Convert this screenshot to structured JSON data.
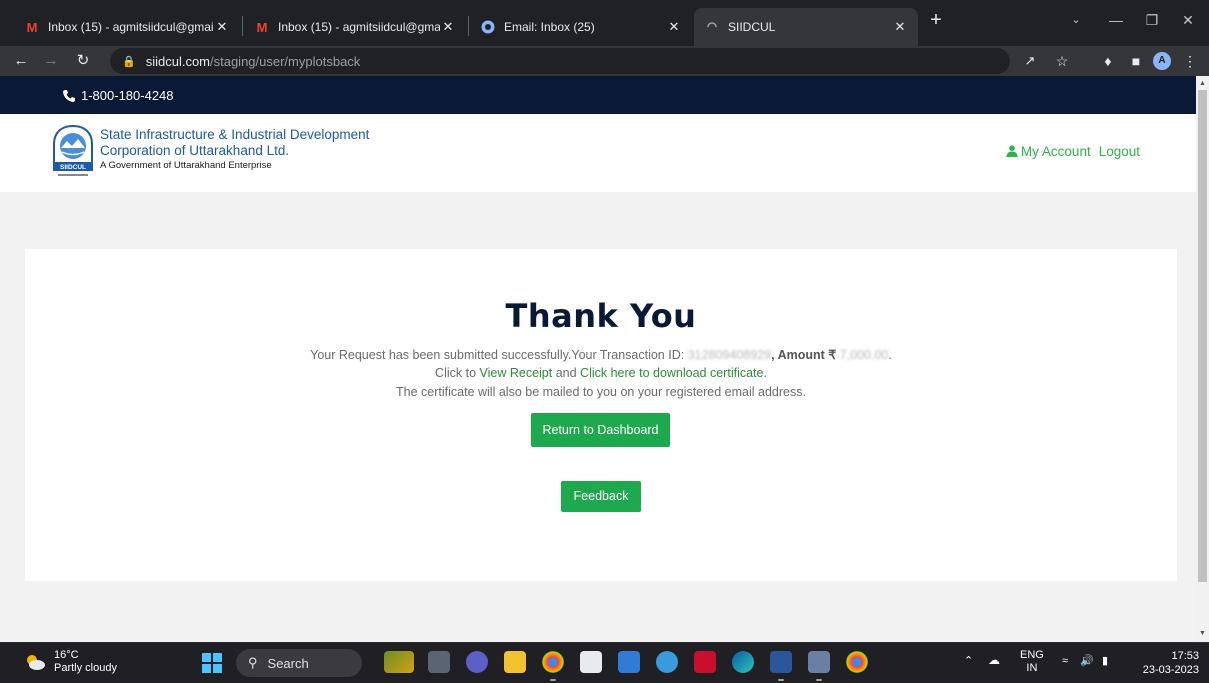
{
  "browser": {
    "tabs": [
      {
        "title": "Inbox (15) - agmitsiidcul@gmail.",
        "favicon": "gmail-icon",
        "close": "✕"
      },
      {
        "title": "Inbox (15) - agmitsiidcul@gmail.",
        "favicon": "gmail-icon",
        "close": "✕"
      },
      {
        "title": "Email: Inbox (25)",
        "favicon": "email-client-icon",
        "close": "✕"
      },
      {
        "title": "SIIDCUL",
        "favicon": "loading-icon",
        "close": "✕"
      }
    ],
    "new_tab": "+",
    "url_host": "siidcul.com",
    "url_path": "/staging/user/myplotsback",
    "profile_initial": "A"
  },
  "site": {
    "phone": "1-800-180-4248",
    "org_line1": "State Infrastructure & Industrial Development",
    "org_line2": "Corporation of Uttarakhand Ltd.",
    "org_line3": "A Government of Uttarakhand Enterprise",
    "logo_text": "SIIDCUL",
    "my_account": "My Account",
    "logout": "Logout"
  },
  "confirmation": {
    "heading": "Thank You",
    "msg_prefix": "Your Request has been submitted successfully.Your Transaction ID: ",
    "transaction_id": "312809408929",
    "amount_label": ", Amount ₹ ",
    "amount_value": "7,000.00",
    "msg_suffix": ".",
    "click_prefix": "Click to ",
    "view_receipt": "View Receipt",
    "and": " and ",
    "download_cert": "Click here to download certificate.",
    "mail_note": "The certificate will also be mailed to you on your registered email address.",
    "return_button": "Return to Dashboard",
    "feedback_button": "Feedback"
  },
  "taskbar": {
    "temperature": "16°C",
    "weather": "Partly cloudy",
    "search": "Search",
    "language_line1": "ENG",
    "language_line2": "IN",
    "time": "17:53",
    "date": "23-03-2023"
  },
  "colors": {
    "brand_navy": "#0a1935",
    "brand_green": "#1fa94f",
    "link_green": "#2e8b3a",
    "org_blue": "#1e5aa8"
  }
}
